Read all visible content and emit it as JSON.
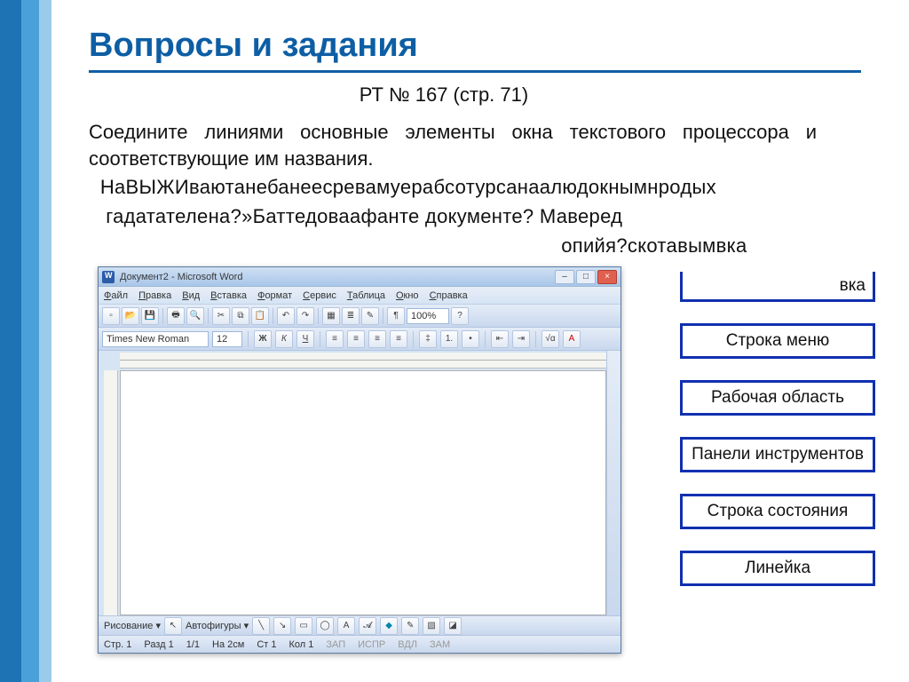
{
  "title": "Вопросы и задания",
  "subtitle": "РТ № 167 (стр. 71)",
  "instruction": "Соедините линиями основные элементы окна текстового процессора и соответствующие им названия.",
  "garbled_lines": [
    "  НаВЫЖИваютанебанеесревамуерабсотурсанаалюдокнымнродых",
    "   гадатателена?»Баттедоваафанте документе? Маверед",
    "                                                                                   опийя?скотавымвка"
  ],
  "labels": {
    "partial": "вка",
    "items": [
      "Строка меню",
      "Рабочая область",
      "Панели инструментов",
      "Строка состояния",
      "Линейка"
    ]
  },
  "word": {
    "title": "Документ2 - Microsoft Word",
    "menu": [
      "Файл",
      "Правка",
      "Вид",
      "Вставка",
      "Формат",
      "Сервис",
      "Таблица",
      "Окно",
      "Справка"
    ],
    "font_name": "Times New Roman",
    "font_size": "12",
    "zoom": "100%",
    "bold": "Ж",
    "italic": "К",
    "underline": "Ч",
    "drawbar_label": "Рисование ▾",
    "autoshapes": "Автофигуры ▾",
    "status": {
      "page": "Стр. 1",
      "section": "Разд 1",
      "pages": "1/1",
      "at": "На 2см",
      "line": "Ст 1",
      "col": "Кол 1",
      "rec": "ЗАП",
      "fix": "ИСПР",
      "ext": "ВДЛ",
      "ovr": "ЗАМ"
    }
  }
}
